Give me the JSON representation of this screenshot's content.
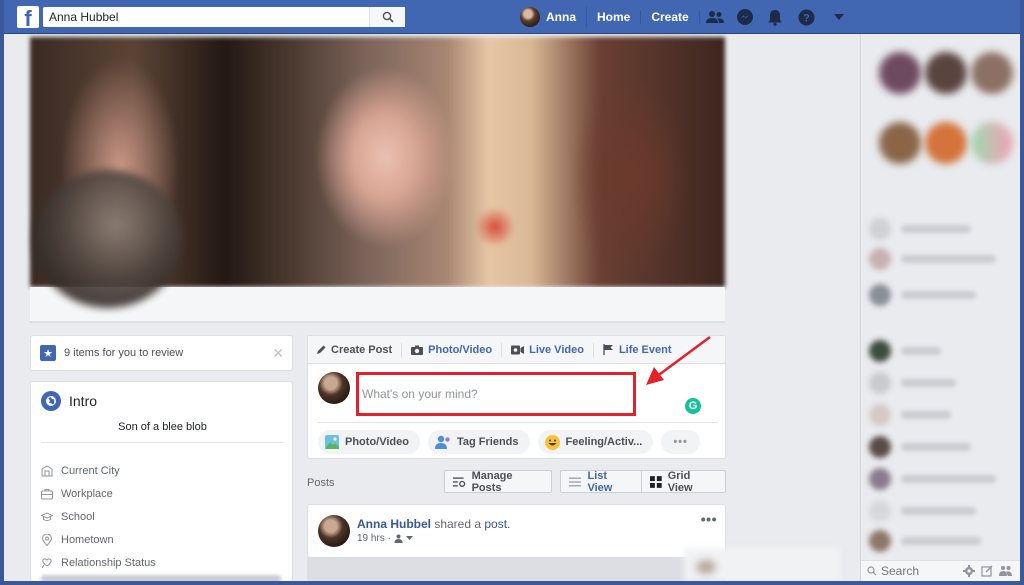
{
  "topbar": {
    "search_value": "Anna Hubbel",
    "search_icon": "search-icon",
    "user_name": "Anna",
    "links": [
      "Home",
      "Create"
    ],
    "icons": [
      "friend-requests-icon",
      "messenger-icon",
      "notifications-icon",
      "help-icon",
      "account-menu-caret-icon"
    ],
    "brand_color": "#4267b2"
  },
  "review": {
    "text": "9 items for you to review",
    "close_icon": "close-icon"
  },
  "intro": {
    "title": "Intro",
    "bio": "Son of a blee blob",
    "items": [
      {
        "label": "Current City",
        "icon": "home-icon"
      },
      {
        "label": "Workplace",
        "icon": "briefcase-icon"
      },
      {
        "label": "School",
        "icon": "graduation-cap-icon"
      },
      {
        "label": "Hometown",
        "icon": "location-pin-icon"
      },
      {
        "label": "Relationship Status",
        "icon": "heart-icon"
      }
    ]
  },
  "composer": {
    "tabs": [
      "Create Post",
      "Photo/Video",
      "Live Video",
      "Life Event"
    ],
    "placeholder": "What's on your mind?",
    "grammarly_label": "G",
    "actions": [
      "Photo/Video",
      "Tag Friends",
      "Feeling/Activ...",
      "•••"
    ],
    "highlight_color": "#e3212b"
  },
  "posts": {
    "label": "Posts",
    "manage_label": "Manage Posts",
    "list_view_label": "List View",
    "grid_view_label": "Grid View",
    "first_post": {
      "author": "Anna Hubbel",
      "action_text": " shared a ",
      "link_text": "post.",
      "time": "19 hrs ·",
      "more": "•••"
    }
  },
  "chat": {
    "search_placeholder": "Search",
    "tool_icons": [
      "settings-gear-icon",
      "new-message-icon",
      "create-group-icon"
    ]
  }
}
